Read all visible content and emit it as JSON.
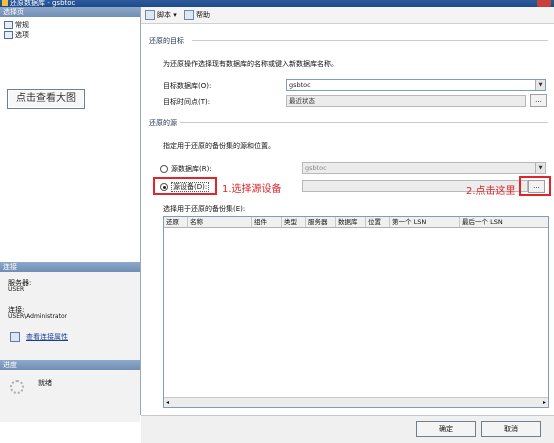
{
  "window": {
    "title": "还原数据库 - gsbtoc"
  },
  "left_pane": {
    "select_page_header": "选择页",
    "pages": [
      {
        "label": "常规",
        "icon": "page-icon"
      },
      {
        "label": "选项",
        "icon": "page-icon"
      }
    ],
    "view_large_image_label": "点击查看大图",
    "connection_header": "连接",
    "server_label": "服务器:",
    "server_value": "USER",
    "connection_label": "连接:",
    "connection_value": "USER\\Administrator",
    "view_connection_props_link": "查看连接属性",
    "progress_header": "进度",
    "progress_status": "就绪"
  },
  "toolbar": {
    "script_label": "脚本",
    "help_label": "帮助"
  },
  "restore_target": {
    "group_title": "还原的目标",
    "description": "为还原操作选择现有数据库的名称或键入新数据库名称。",
    "target_db_label": "目标数据库(O):",
    "target_db_value": "gsbtoc",
    "target_time_label": "目标时间点(T):",
    "target_time_value": "最近状态",
    "browse_label": "..."
  },
  "restore_source": {
    "group_title": "还原的源",
    "description": "指定用于还原的备份集的源和位置。",
    "source_db_label": "源数据库(R):",
    "source_db_value": "gsbtoc",
    "source_device_label": "源设备(D):",
    "device_browse_label": "..."
  },
  "annotations": {
    "step1": "1.选择源设备",
    "step2": "2.点击这里"
  },
  "backup_sets": {
    "label": "选择用于还原的备份集(E):",
    "columns": [
      "还原",
      "名称",
      "组件",
      "类型",
      "服务器",
      "数据库",
      "位置",
      "第一个 LSN",
      "最后一个 LSN"
    ],
    "rows": []
  },
  "buttons": {
    "ok": "确定",
    "cancel": "取消"
  },
  "colors": {
    "accent_red": "#e0262b",
    "titlebar_blue": "#1f4a88",
    "section_header": "#7a98c0"
  }
}
